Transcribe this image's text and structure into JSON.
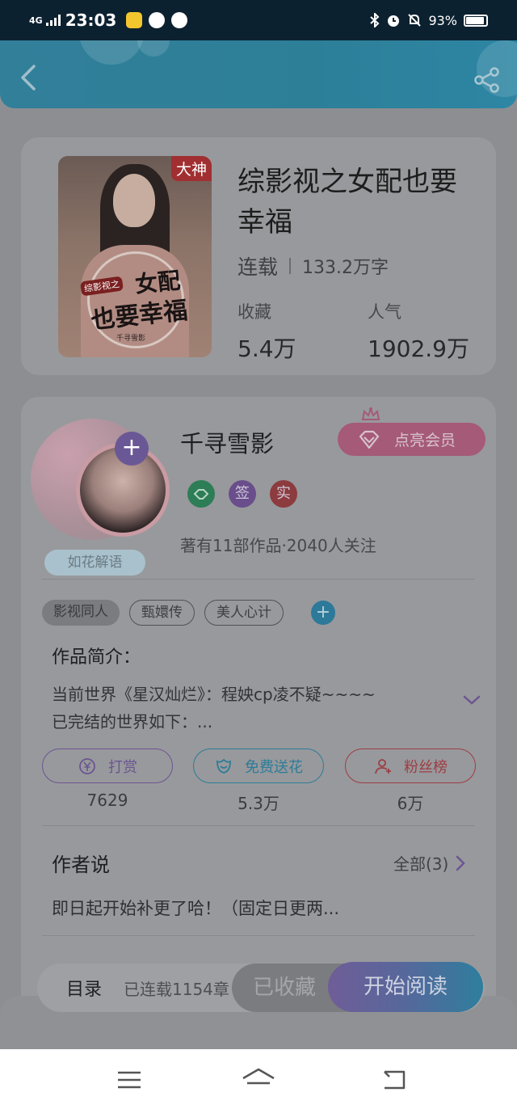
{
  "status_bar": {
    "network": "4G",
    "time": "23:03",
    "battery": "93%",
    "battery_level": 0.93
  },
  "header": {
    "back_icon": "chevron-left-icon",
    "share_icon": "share-icon"
  },
  "book": {
    "cover_badge": "大神",
    "cover_title_line1": "女配",
    "cover_title_line2": "也要幸福",
    "cover_subtitle": "综影视之",
    "cover_author": "千寻雪影",
    "title": "综影视之女配也要幸福",
    "status": "连载",
    "word_count": "133.2万字",
    "stats": [
      {
        "label": "收藏",
        "value": "5.4万"
      },
      {
        "label": "人气",
        "value": "1902.9万"
      }
    ]
  },
  "author": {
    "name": "千寻雪影",
    "frame_tag": "如花解语",
    "follow_plus": "+",
    "vip_button": "点亮会员",
    "badges": [
      {
        "label": "",
        "color": "#2d7d57",
        "icon": "handshake-icon"
      },
      {
        "label": "签",
        "color": "#6a4e8c"
      },
      {
        "label": "实",
        "color": "#8c3b3e"
      }
    ],
    "meta": "著有11部作品·2040人关注"
  },
  "tags": [
    "影视同人",
    "甄嬛传",
    "美人心计"
  ],
  "tag_add": "+",
  "intro": {
    "title": "作品简介：",
    "text_line1": "当前世界《星汉灿烂》：程姎cp凌不疑~~~~",
    "text_line2": "已完结的世界如下：..."
  },
  "actions": [
    {
      "label": "打赏",
      "count": "7629",
      "color": "#6b5592",
      "icon": "yen-coin-icon"
    },
    {
      "label": "免费送花",
      "count": "5.3万",
      "color": "#2c7c99",
      "icon": "flower-icon"
    },
    {
      "label": "粉丝榜",
      "count": "6万",
      "color": "#9b3e44",
      "icon": "fans-icon"
    }
  ],
  "author_says": {
    "title": "作者说",
    "all_label": "全部(3)",
    "text": "即日起开始补更了哈！（固定日更两..."
  },
  "bottom_bar": {
    "toc_label": "目录",
    "toc_count": "已连载1154章",
    "favorite_label": "已收藏",
    "read_label": "开始阅读"
  },
  "colors": {
    "status_bar": "#0c2130",
    "header": "#2d7f98",
    "overlay_bg": "#8d8e91",
    "card_bg": "#98999c",
    "navbar": "#ffffff"
  }
}
